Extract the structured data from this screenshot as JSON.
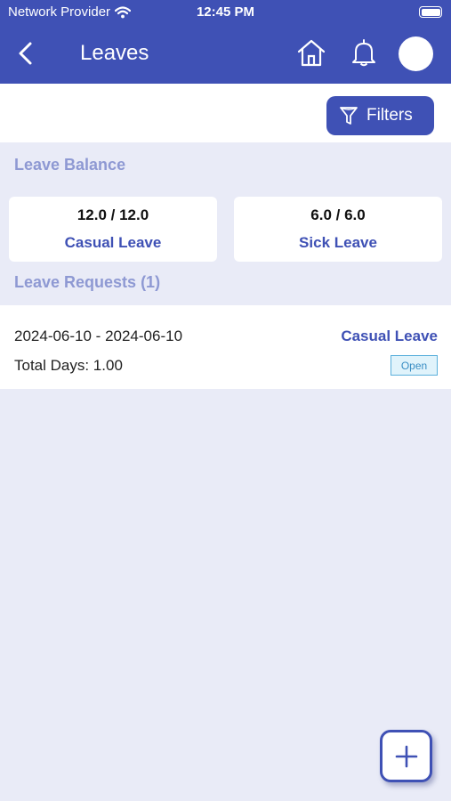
{
  "status_bar": {
    "carrier": "Network Provider",
    "time": "12:45 PM"
  },
  "header": {
    "title": "Leaves"
  },
  "toolbar": {
    "filters_label": "Filters"
  },
  "leave_balance": {
    "heading": "Leave Balance",
    "cards": [
      {
        "value": "12.0 / 12.0",
        "type": "Casual Leave"
      },
      {
        "value": "6.0 / 6.0",
        "type": "Sick Leave"
      }
    ]
  },
  "leave_requests": {
    "heading": "Leave Requests (1)",
    "items": [
      {
        "dates": "2024-06-10 - 2024-06-10",
        "total_days": "Total Days: 1.00",
        "type": "Casual Leave",
        "status": "Open"
      }
    ]
  },
  "colors": {
    "primary": "#3f51b5",
    "background": "#e9ebf7",
    "heading": "#8e99d3",
    "badge": "#5bb0dc"
  },
  "icons": [
    "wifi-icon",
    "battery-icon",
    "back-arrow-icon",
    "home-icon",
    "bell-icon",
    "filter-icon",
    "plus-icon"
  ]
}
